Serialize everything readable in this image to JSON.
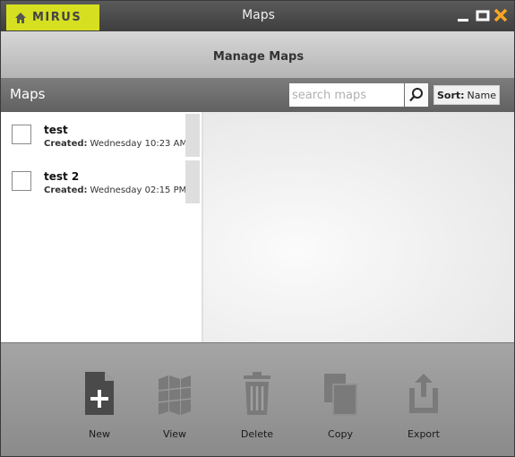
{
  "titlebar": {
    "logo_text": "MIRUS",
    "title": "Maps",
    "icons": [
      "home-icon",
      "minimize-icon",
      "maximize-icon",
      "close-icon"
    ]
  },
  "header": {
    "title": "Manage Maps"
  },
  "toolbar": {
    "heading": "Maps",
    "search_placeholder": "search maps",
    "sort_prefix": "Sort:",
    "sort_value": "Name"
  },
  "maps": [
    {
      "name": "test",
      "created_label": "Created:",
      "created_value": "Wednesday 10:23 AM"
    },
    {
      "name": "test 2",
      "created_label": "Created:",
      "created_value": "Wednesday 02:15 PM"
    }
  ],
  "actions": {
    "new": "New",
    "view": "View",
    "delete": "Delete",
    "copy": "Copy",
    "export": "Export"
  },
  "colors": {
    "brand": "#d6e021",
    "close": "#f5a623",
    "icon_enabled": "#4a4a4a",
    "icon_disabled": "#7a7a7a"
  }
}
